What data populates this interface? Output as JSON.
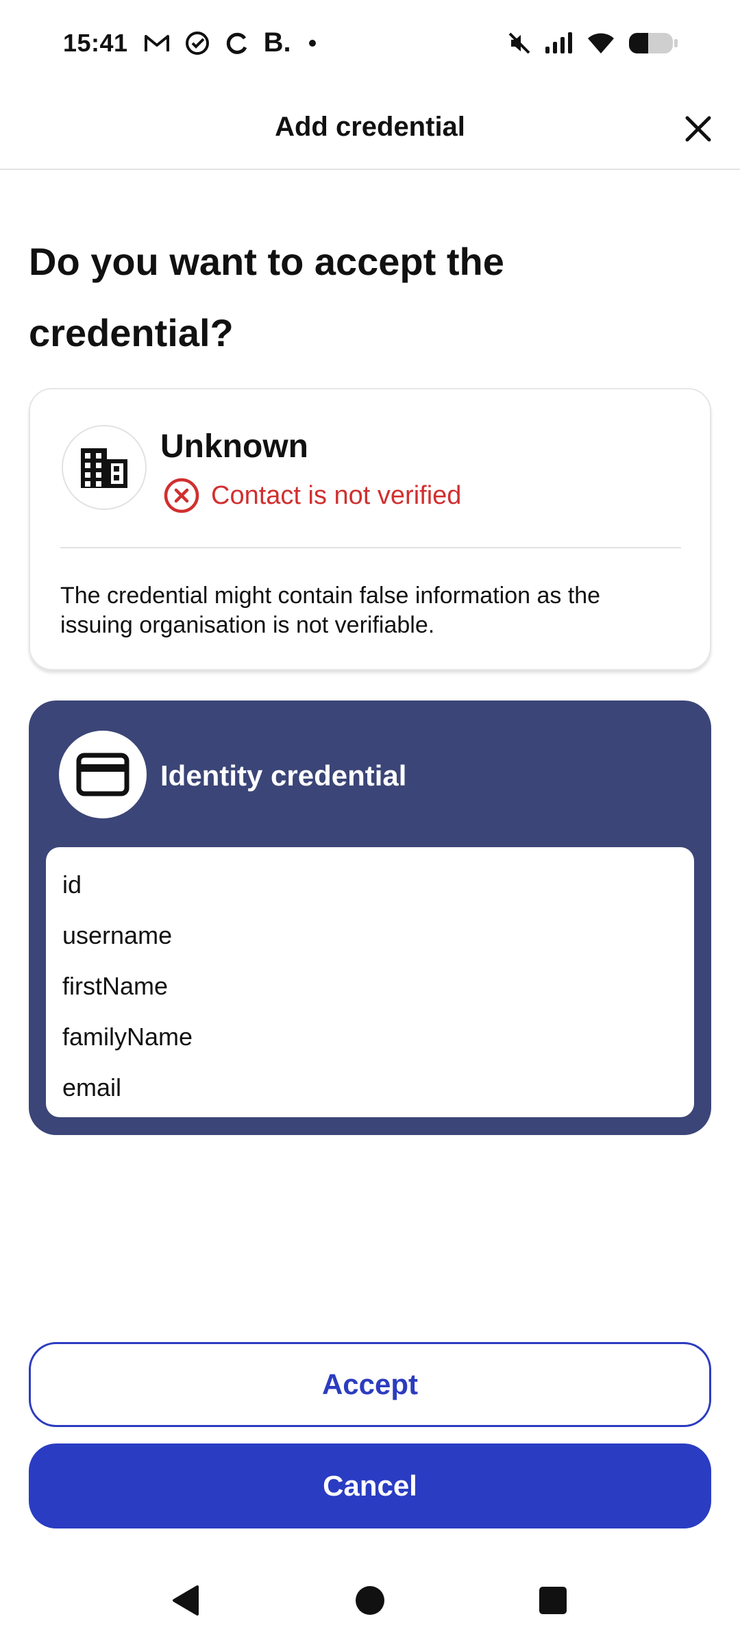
{
  "status_bar": {
    "time": "15:41",
    "b_glyph": "B.",
    "icons": [
      "gmail-icon",
      "task-check-icon",
      "sync-icon",
      "b-app-icon",
      "notification-dot",
      "mute-icon",
      "signal-icon",
      "wifi-icon",
      "battery-icon"
    ]
  },
  "app_bar": {
    "title": "Add credential",
    "close_icon": "close-icon"
  },
  "question": "Do you want to accept the credential?",
  "issuer": {
    "name": "Unknown",
    "logo_icon": "building-icon",
    "verification_status": "Contact is not verified",
    "status_icon": "error-circle-icon",
    "warning": "The credential might contain false information as the issuing organisation is not verifiable.",
    "colors": {
      "error": "#d12f2f"
    }
  },
  "credential": {
    "title": "Identity credential",
    "icon": "credit-card-icon",
    "attributes": [
      "id",
      "username",
      "firstName",
      "familyName",
      "email"
    ],
    "colors": {
      "card_background": "#3b4577"
    }
  },
  "actions": {
    "accept_label": "Accept",
    "cancel_label": "Cancel",
    "colors": {
      "primary": "#2a3cc2"
    }
  },
  "nav_bar": {
    "back_icon": "back-triangle-icon",
    "home_icon": "home-circle-icon",
    "recents_icon": "recents-square-icon"
  }
}
